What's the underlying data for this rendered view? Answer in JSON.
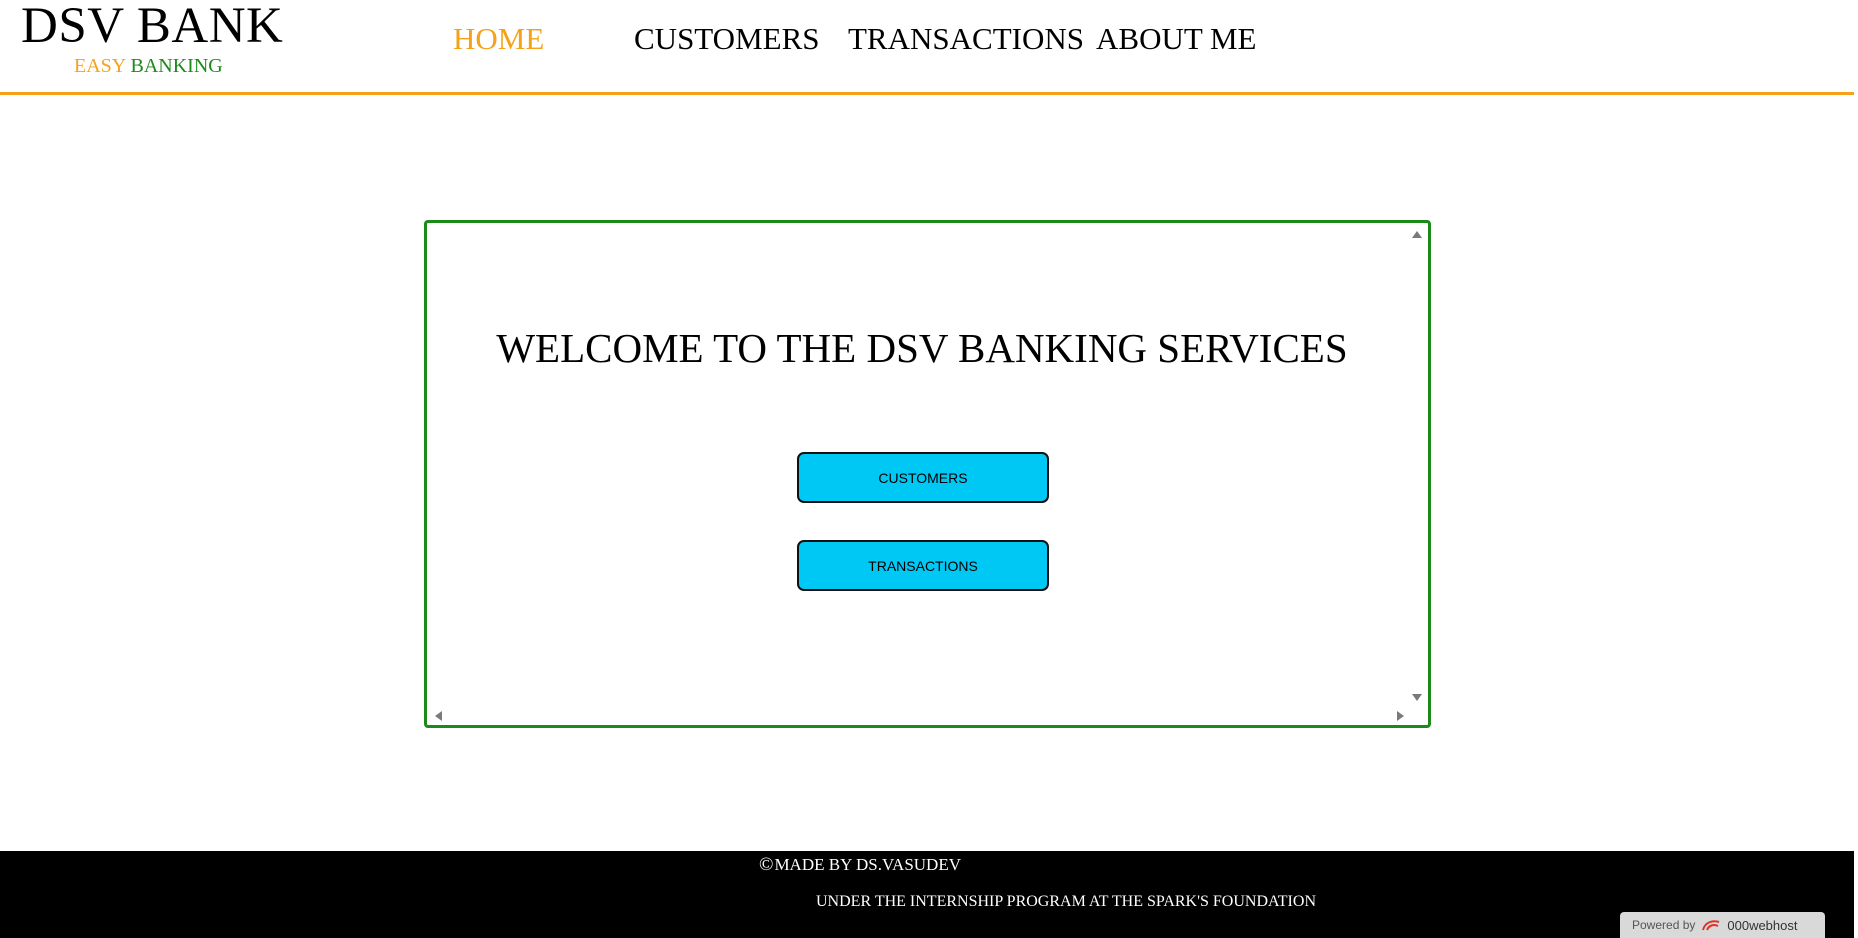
{
  "brand": {
    "title": "DSV BANK",
    "tagline_part1": "EASY",
    "tagline_part2": "BANKING"
  },
  "nav": {
    "items": [
      {
        "label": "HOME",
        "active": true
      },
      {
        "label": "CUSTOMERS",
        "active": false
      },
      {
        "label": "TRANSACTIONS",
        "active": false
      },
      {
        "label": "ABOUT ME",
        "active": false
      }
    ]
  },
  "main": {
    "welcome_text": "WELCOME TO THE DSV BANKING SERVICES",
    "customers_button": "CUSTOMERS",
    "transactions_button": "TRANSACTIONS"
  },
  "footer": {
    "copyright_symbol": "©",
    "made_by": "MADE BY DS.VASUDEV",
    "internship": "UNDER THE INTERNSHIP PROGRAM AT THE SPARK'S FOUNDATION"
  },
  "badge": {
    "powered_by": "Powered by",
    "host": "000webhost"
  },
  "colors": {
    "accent_orange": "#f5a21a",
    "accent_green": "#1b8a1b",
    "button_cyan": "#00c8f4",
    "footer_bg": "#000000"
  }
}
